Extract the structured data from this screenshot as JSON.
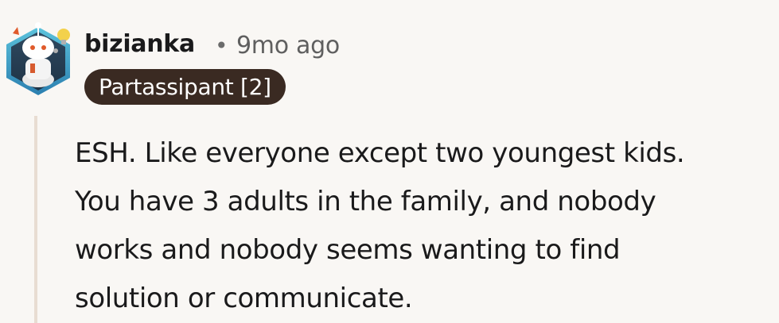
{
  "comment": {
    "author": "bizianka",
    "separator": "•",
    "timestamp": "9mo ago",
    "flair": "Partassipant [2]",
    "body_lines": [
      "ESH. Like everyone except two youngest kids.",
      "You have 3 adults in the family, and nobody",
      "works and nobody seems wanting to find",
      "solution or communicate."
    ]
  },
  "avatar": {
    "icon": "reddit-snoo-avatar-icon",
    "hex_border_color": "#3aa0c8"
  },
  "colors": {
    "background": "#f9f7f4",
    "flair_background": "#3a2a22",
    "thread_line": "#e8ddd2"
  }
}
